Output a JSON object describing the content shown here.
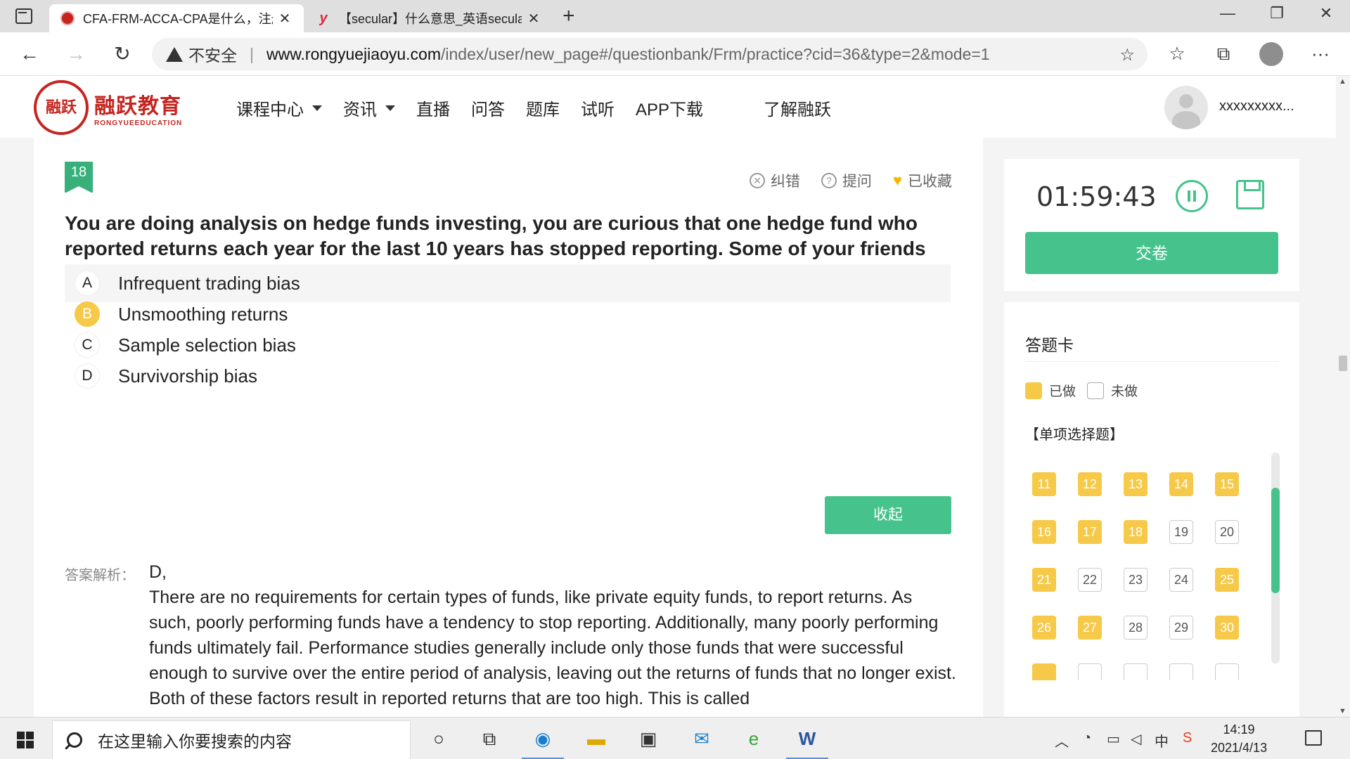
{
  "browser": {
    "tabs": [
      {
        "title": "CFA-FRM-ACCA-CPA是什么，注册…",
        "active": true,
        "icon": "site-logo-favicon"
      },
      {
        "title": "【secular】什么意思_英语secular…",
        "active": false,
        "icon": "youdao-favicon"
      }
    ],
    "close_glyph": "✕",
    "new_tab_glyph": "+",
    "window_controls": [
      "—",
      "❐",
      "✕"
    ],
    "nav": {
      "back": "←",
      "forward": "→",
      "reload": "↻"
    },
    "security_label": "不安全",
    "url_domain": "www.rongyuejiaoyu.com",
    "url_path": "/index/user/new_page#/questionbank/Frm/practice?cid=36&type=2&mode=1",
    "toolbar_glyphs": {
      "fav_add": "☆",
      "favorites": "☆",
      "collections": "⧉",
      "more": "···"
    }
  },
  "site": {
    "logo_seal": "融跃",
    "logo_cn": "融跃教育",
    "logo_en": "RONGYUEEDUCATION",
    "menu": [
      {
        "label": "课程中心",
        "dropdown": true
      },
      {
        "label": "资讯",
        "dropdown": true
      },
      {
        "label": "直播",
        "dropdown": false
      },
      {
        "label": "问答",
        "dropdown": false
      },
      {
        "label": "题库",
        "dropdown": false
      },
      {
        "label": "试听",
        "dropdown": false
      },
      {
        "label": "APP下载",
        "dropdown": false
      },
      {
        "label": "了解融跃",
        "dropdown": false
      }
    ],
    "user_name": "xxxxxxxxx..."
  },
  "question": {
    "number": "18",
    "actions": {
      "report": "纠错",
      "ask": "提问",
      "favorited": "已收藏"
    },
    "text": "You are doing analysis on hedge funds investing, you are curious that one hedge fund who reported returns each year for the last 10 years has stopped reporting. Some of your friends told you that the fund has suffered a big loss this year. This reflects:",
    "options": [
      {
        "letter": "A",
        "text": "Infrequent trading bias",
        "selected": false
      },
      {
        "letter": "B",
        "text": "Unsmoothing returns",
        "selected": true
      },
      {
        "letter": "C",
        "text": "Sample selection bias",
        "selected": false
      },
      {
        "letter": "D",
        "text": "Survivorship bias",
        "selected": false
      }
    ],
    "collapse_label": "收起",
    "analysis_label": "答案解析：",
    "answer_key": "D,",
    "explanation": "There are no requirements for certain types of funds, like private equity funds, to report returns. As such, poorly performing funds have a tendency to stop reporting. Additionally, many poorly performing funds ultimately fail. Performance studies generally include only those funds that were successful enough to survive over the entire period of analysis, leaving out the returns of funds that no longer exist. Both of these factors result in reported returns that are too high. This is called"
  },
  "timer": {
    "time": "01:59:43",
    "submit_label": "交卷"
  },
  "answer_card": {
    "title": "答题卡",
    "legend_done": "已做",
    "legend_todo": "未做",
    "section": "【单项选择题】",
    "cells": [
      {
        "n": "11",
        "done": true
      },
      {
        "n": "12",
        "done": true
      },
      {
        "n": "13",
        "done": true
      },
      {
        "n": "14",
        "done": true
      },
      {
        "n": "15",
        "done": true
      },
      {
        "n": "16",
        "done": true
      },
      {
        "n": "17",
        "done": true
      },
      {
        "n": "18",
        "done": true
      },
      {
        "n": "19",
        "done": false
      },
      {
        "n": "20",
        "done": false
      },
      {
        "n": "21",
        "done": true
      },
      {
        "n": "22",
        "done": false
      },
      {
        "n": "23",
        "done": false
      },
      {
        "n": "24",
        "done": false
      },
      {
        "n": "25",
        "done": true
      },
      {
        "n": "26",
        "done": true
      },
      {
        "n": "27",
        "done": true
      },
      {
        "n": "28",
        "done": false
      },
      {
        "n": "29",
        "done": false
      },
      {
        "n": "30",
        "done": true
      },
      {
        "n": "",
        "done": true
      },
      {
        "n": "",
        "done": false
      },
      {
        "n": "",
        "done": false
      },
      {
        "n": "",
        "done": false
      },
      {
        "n": "",
        "done": false
      }
    ]
  },
  "taskbar": {
    "search_placeholder": "在这里输入你要搜索的内容",
    "ime": "中",
    "time": "14:19",
    "date": "2021/4/13"
  },
  "colors": {
    "brand_red": "#c5241f",
    "accent_green": "#46c38c",
    "done_yellow": "#f7c948"
  }
}
